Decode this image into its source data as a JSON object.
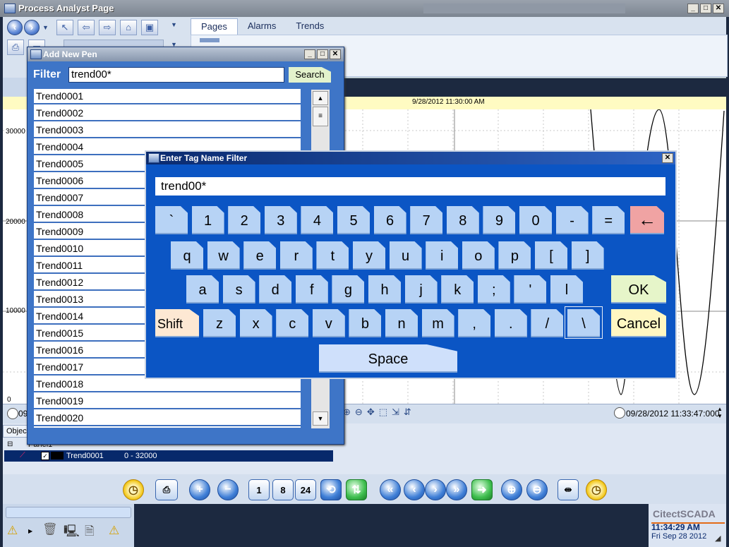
{
  "main_window": {
    "title": "Process Analyst Page"
  },
  "tabs": [
    {
      "label": "Pages",
      "active": true
    },
    {
      "label": "Alarms"
    },
    {
      "label": "Trends"
    }
  ],
  "trend": {
    "date_label": "9/28/2012 11:30:00 AM",
    "y_ticks": [
      "30000",
      "20000",
      "10000",
      "0"
    ],
    "left_time_partial": "09",
    "end_time": "09/28/2012 11:33:47:000"
  },
  "objects_panel": {
    "tab_label": "Objec",
    "tree_label": "Panel1",
    "pen": {
      "name": "Trend0001",
      "range": "0 - 32000"
    }
  },
  "add_pen_dialog": {
    "title": "Add New Pen",
    "filter_label": "Filter",
    "filter_value": "trend00*",
    "search_label": "Search",
    "items": [
      "Trend0001",
      "Trend0002",
      "Trend0003",
      "Trend0004",
      "Trend0005",
      "Trend0006",
      "Trend0007",
      "Trend0008",
      "Trend0009",
      "Trend0010",
      "Trend0011",
      "Trend0012",
      "Trend0013",
      "Trend0014",
      "Trend0015",
      "Trend0016",
      "Trend0017",
      "Trend0018",
      "Trend0019",
      "Trend0020"
    ]
  },
  "keyboard_dialog": {
    "title": "Enter Tag Name Filter",
    "input_value": "trend00*",
    "rows": [
      [
        "`",
        "1",
        "2",
        "3",
        "4",
        "5",
        "6",
        "7",
        "8",
        "9",
        "0",
        "-",
        "="
      ],
      [
        "q",
        "w",
        "e",
        "r",
        "t",
        "y",
        "u",
        "i",
        "o",
        "p",
        "[",
        "]"
      ],
      [
        "a",
        "s",
        "d",
        "f",
        "g",
        "h",
        "j",
        "k",
        ";",
        "'",
        "l"
      ],
      [
        "z",
        "x",
        "c",
        "v",
        "b",
        "n",
        "m",
        ",",
        ".",
        "/",
        "\\"
      ]
    ],
    "backspace_label": "←",
    "shift_label": "Shift",
    "ok_label": "OK",
    "cancel_label": "Cancel",
    "space_label": "Space"
  },
  "bottom_toolbar": {
    "page_buttons": [
      "1",
      "8",
      "24"
    ]
  },
  "status": {
    "brand": "CitectSCADA",
    "time": "11:34:29 AM",
    "date": "Fri Sep 28 2012"
  },
  "colors": {
    "accent": "#0b55c4",
    "key_face": "#b7d3f5",
    "shift": "#fde8d3",
    "backspace": "#f0a3a3",
    "ok": "#e6f5c9",
    "cancel": "#fff7c2"
  }
}
